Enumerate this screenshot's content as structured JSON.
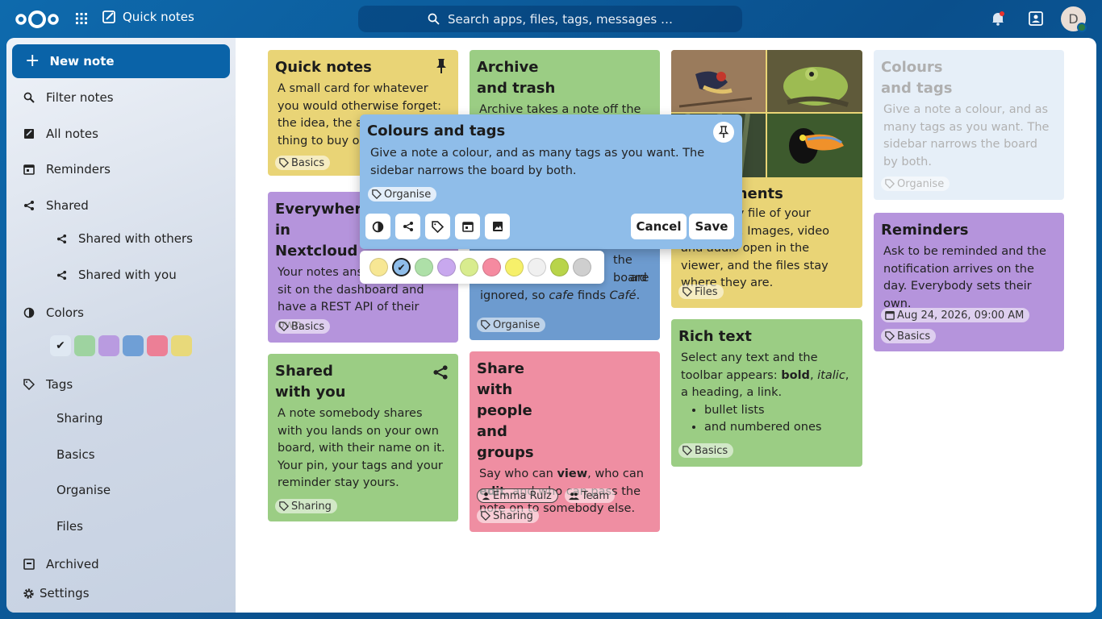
{
  "header": {
    "app_name": "Quick notes",
    "search_placeholder": "Search apps, files, tags, messages …",
    "avatar_letter": "D"
  },
  "sidebar": {
    "new_note": "New note",
    "filter": "Filter notes",
    "all": "All notes",
    "reminders": "Reminders",
    "shared": "Shared",
    "shared_with_others": "Shared with others",
    "shared_with_you": "Shared with you",
    "colors": "Colors",
    "color_swatches": [
      "#dfe8f2",
      "#9ed3a0",
      "#b99be0",
      "#6f9fd6",
      "#ec7f96",
      "#e8d97a"
    ],
    "tags": "Tags",
    "tag_items": [
      "Sharing",
      "Basics",
      "Organise",
      "Files"
    ],
    "archived": "Archived",
    "settings": "Settings"
  },
  "cards": {
    "quick": {
      "title": "Quick notes",
      "body": "A small card for whatever you would otherwise forget: the idea, the address, the thing to buy on the way",
      "tag": "Basics",
      "color": "#e9d476"
    },
    "archive": {
      "title": "Archive and trash",
      "body": "Archive takes a note off the",
      "color": "#9bcd84"
    },
    "everywhere": {
      "title": "Everywhere in Nextcloud",
      "body": "Your notes answer to search, sit on the dashboard and have a REST API of their own.",
      "tag": "Basics",
      "color": "#b594dc"
    },
    "search": {
      "body_a": "the board",
      "body_b": "are",
      "body_c": "ignored, so ",
      "cafe1": "cafe",
      "finds": " finds ",
      "cafe2": "Café",
      "period": ".",
      "tag": "Organise",
      "color": "#6d9bcf"
    },
    "attachments": {
      "title": "Attachments",
      "body": "Attach any file of your Nextcloud. Images, video and audio open in the viewer, and the files stay where they are.",
      "tag": "Files",
      "color": "#e9d476"
    },
    "colours_faded": {
      "title": "Colours and tags",
      "body": "Give a note a colour, and as many tags as you want. The sidebar narrows the board by both.",
      "tag": "Organise",
      "color": "#b9d2ec"
    },
    "reminders": {
      "title": "Reminders",
      "body": "Ask to be reminded and the notification arrives on the day. Everybody sets their own.",
      "date": "Aug 24, 2026, 09:00 AM",
      "tag": "Basics",
      "color": "#b594dc"
    },
    "shared_you": {
      "title": "Shared with you",
      "body": "A note somebody shares with you lands on your own board, with their name on it. Your pin, your tags and your reminder stay yours.",
      "tag": "Sharing",
      "color": "#9bcd84"
    },
    "share_people": {
      "title": "Share with people and groups",
      "t1": "Say who can ",
      "view": "view",
      "t2": ", who can ",
      "edit": "edit",
      "t3": ", and who can pass the note on to somebody else.",
      "person": "Emma Ruiz",
      "group": "Team",
      "tag": "Sharing",
      "color": "#ef8ea2"
    },
    "rich": {
      "title": "Rich text",
      "t1": "Select any text and the toolbar appears: ",
      "bold": "bold",
      "comma": ", ",
      "italic": "italic",
      "t2": ", a heading, a link.",
      "li1": "bullet lists",
      "li2": "and numbered ones",
      "tag": "Basics",
      "color": "#9bcd84"
    }
  },
  "editor": {
    "title": "Colours and tags",
    "body": "Give a note a colour, and as many tags as you want. The sidebar narrows the board by both.",
    "tag": "Organise",
    "cancel": "Cancel",
    "save": "Save",
    "color": "#8fbde9"
  },
  "palette": [
    "#f7e794",
    "#8fbde9",
    "#aee0a8",
    "#c8a8ee",
    "#d8ec8e",
    "#f58aa0",
    "#f6f06a",
    "#f0f0f0",
    "#b8d44a",
    "#cfcfcf"
  ],
  "palette_selected": 1
}
